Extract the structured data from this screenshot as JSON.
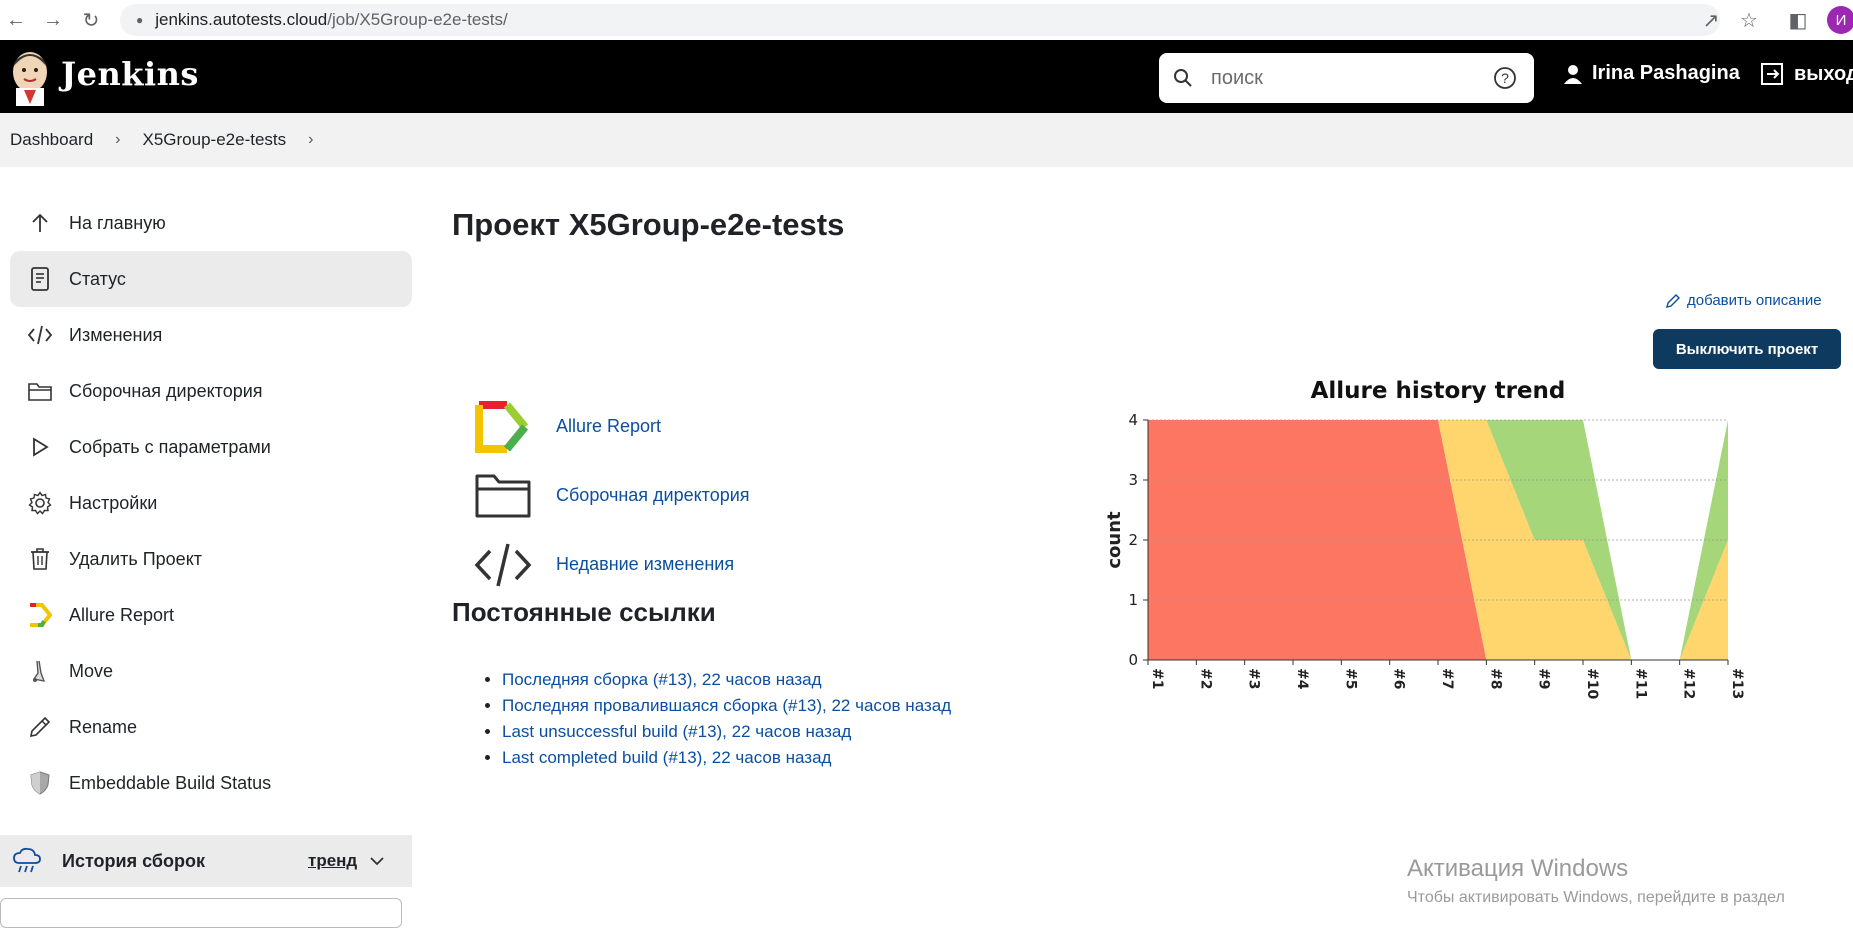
{
  "browser": {
    "url_host": "jenkins.autotests.cloud",
    "url_path": "/job/X5Group-e2e-tests/",
    "avatar_letter": "И"
  },
  "header": {
    "title": "Jenkins",
    "search_placeholder": "поиск",
    "user_name": "Irina Pashagina",
    "logout_label": "выход"
  },
  "breadcrumb": [
    {
      "label": "Dashboard"
    },
    {
      "label": "X5Group-e2e-tests"
    }
  ],
  "sidebar": {
    "items": [
      {
        "label": "На главную",
        "icon": "arrow-up-icon"
      },
      {
        "label": "Статус",
        "icon": "document-icon",
        "active": true
      },
      {
        "label": "Изменения",
        "icon": "code-icon"
      },
      {
        "label": "Сборочная директория",
        "icon": "folder-icon"
      },
      {
        "label": "Собрать с параметрами",
        "icon": "play-icon"
      },
      {
        "label": "Настройки",
        "icon": "gear-icon"
      },
      {
        "label": "Удалить Проект",
        "icon": "trash-icon"
      },
      {
        "label": "Allure Report",
        "icon": "allure-icon"
      },
      {
        "label": "Move",
        "icon": "move-icon"
      },
      {
        "label": "Rename",
        "icon": "pencil-icon"
      },
      {
        "label": "Embeddable Build Status",
        "icon": "shield-icon"
      }
    ],
    "history": {
      "label": "История сборок",
      "trend_label": "тренд"
    }
  },
  "main": {
    "title": "Проект X5Group-e2e-tests",
    "add_description": "добавить описание",
    "disable_button": "Выключить проект",
    "links": [
      {
        "label": "Allure Report",
        "icon": "allure-icon"
      },
      {
        "label": "Сборочная директория",
        "icon": "folder-icon"
      },
      {
        "label": "Недавние изменения",
        "icon": "code-icon"
      }
    ],
    "permalinks_title": "Постоянные ссылки",
    "permalinks": [
      "Последняя сборка (#13), 22 часов назад",
      "Последняя провалившаяся сборка (#13), 22 часов назад",
      "Last unsuccessful build (#13), 22 часов назад",
      "Last completed build (#13), 22 часов назад"
    ]
  },
  "chart_data": {
    "type": "area",
    "title": "Allure history trend",
    "ylabel": "count",
    "xlabel": "",
    "categories": [
      "#1",
      "#2",
      "#3",
      "#4",
      "#5",
      "#6",
      "#7",
      "#8",
      "#9",
      "#10",
      "#11",
      "#12",
      "#13"
    ],
    "ylim": [
      0,
      4
    ],
    "yticks": [
      0,
      1,
      2,
      3,
      4
    ],
    "grid": true,
    "stacked": true,
    "series": [
      {
        "values": [
          4,
          4,
          4,
          4,
          4,
          4,
          4,
          0,
          0,
          0,
          0,
          0,
          0
        ],
        "color": "#fd7661"
      },
      {
        "values": [
          0,
          0,
          0,
          0,
          0,
          0,
          0,
          4,
          2,
          2,
          0,
          0,
          2
        ],
        "color": "#ffd66e"
      },
      {
        "values": [
          0,
          0,
          0,
          0,
          0,
          0,
          0,
          0,
          2,
          2,
          0,
          0,
          2
        ],
        "color": "#a5d67a"
      }
    ]
  },
  "watermark": {
    "line1": "Активация Windows",
    "line2": "Чтобы активировать Windows, перейдите в раздел"
  }
}
